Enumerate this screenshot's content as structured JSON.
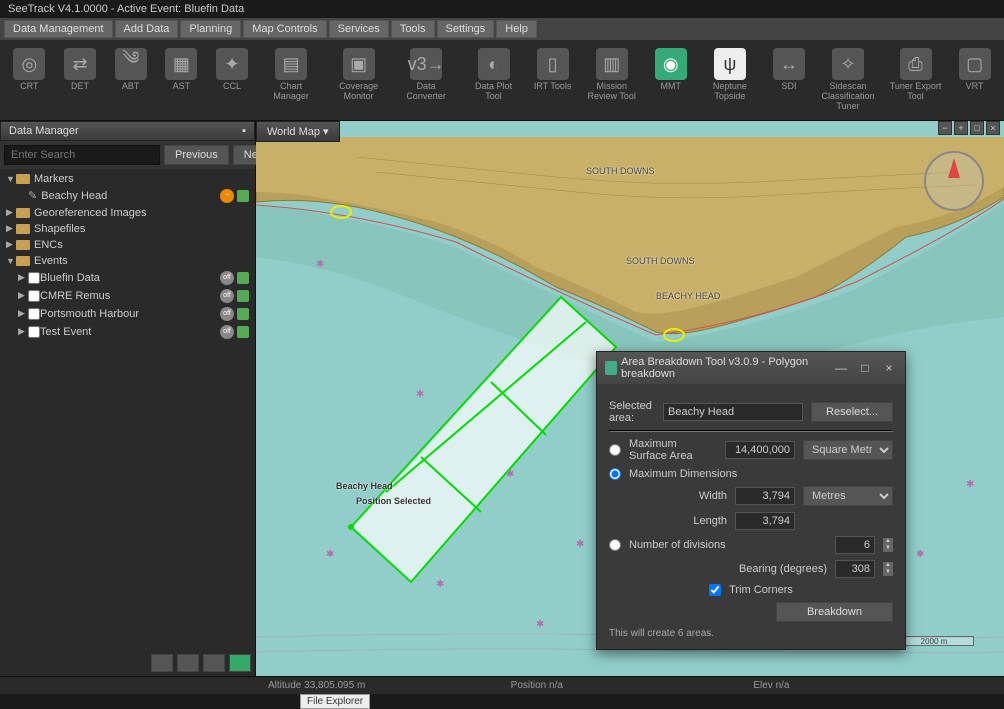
{
  "title": "SeeTrack V4.1.0000 - Active Event: Bluefin Data",
  "menu": [
    "Data Management",
    "Add Data",
    "Planning",
    "Map Controls",
    "Services",
    "Tools",
    "Settings",
    "Help"
  ],
  "toolbar": [
    {
      "label": "CRT"
    },
    {
      "label": "DET"
    },
    {
      "label": "ABT"
    },
    {
      "label": "AST"
    },
    {
      "label": "CCL"
    },
    {
      "label": "Chart Manager"
    },
    {
      "label": "Coverage Monitor"
    },
    {
      "label": "Data Converter"
    },
    {
      "label": "Data Plot Tool"
    },
    {
      "label": "IRT Tools"
    },
    {
      "label": "Mission Review Tool"
    },
    {
      "label": "MMT"
    },
    {
      "label": "Neptune Topside"
    },
    {
      "label": "SDI"
    },
    {
      "label": "Sidescan Classification Tuner"
    },
    {
      "label": "Tuner Export Tool"
    },
    {
      "label": "VRT"
    }
  ],
  "left": {
    "header": "Data Manager",
    "search_ph": "Enter Search",
    "prev": "Previous",
    "next": "Next",
    "tree": {
      "markers": "Markers",
      "marker_bh": "Beachy Head",
      "geo": "Georeferenced Images",
      "shp": "Shapefiles",
      "enc": "ENCs",
      "events": "Events",
      "ev1": "Bluefin Data",
      "ev2": "CMRE Remus",
      "ev3": "Portsmouth Harbour",
      "ev4": "Test Event"
    }
  },
  "map": {
    "tab": "World Map",
    "labels": {
      "sd1": "SOUTH DOWNS",
      "sd2": "SOUTH DOWNS",
      "bh": "BEACHY HEAD",
      "area_bh": "Beachy Head",
      "area_ps": "Position Selected"
    },
    "scale": "2000 m"
  },
  "dialog": {
    "title": "Area Breakdown Tool v3.0.9 - Polygon breakdown",
    "sel_label": "Selected area:",
    "sel_value": "Beachy Head",
    "reselect": "Reselect...",
    "opt_msa": "Maximum Surface Area",
    "msa_val": "14,400,000",
    "msa_unit": "Square Metres",
    "opt_md": "Maximum Dimensions",
    "width_l": "Width",
    "width_v": "3,794",
    "width_u": "Metres",
    "length_l": "Length",
    "length_v": "3,794",
    "opt_nd": "Number of divisions",
    "nd_v": "6",
    "bearing_l": "Bearing (degrees)",
    "bearing_v": "308",
    "trim": "Trim Corners",
    "breakdown": "Breakdown",
    "msg": "This will create 6 areas."
  },
  "status": {
    "alt": "Altitude 33,805.095 m",
    "pos": "Position n/a",
    "elev": "Elev n/a",
    "file_exp": "File Explorer"
  }
}
